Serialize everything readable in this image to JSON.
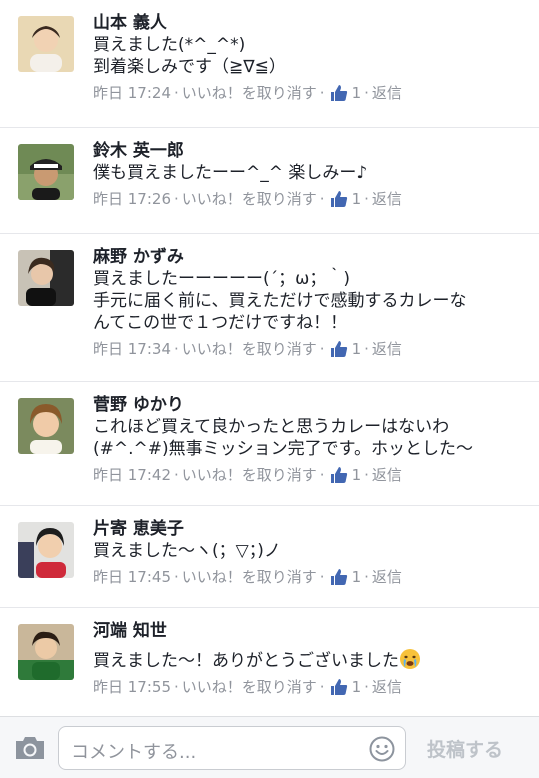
{
  "comments": [
    {
      "name": "山本 義人",
      "lines": [
        "買えました(*^_^*)",
        "到着楽しみです（≧∇≦）"
      ],
      "time": "昨日 17:24",
      "unlike": "いいね！を取り消す",
      "likes": "1",
      "reply": "返信"
    },
    {
      "name": "鈴木 英一郎",
      "lines": [
        "僕も買えましたーー^_^ 楽しみー♪"
      ],
      "time": "昨日 17:26",
      "unlike": "いいね！を取り消す",
      "likes": "1",
      "reply": "返信"
    },
    {
      "name": "麻野 かずみ",
      "lines": [
        "買えましたーーーーー(´；ω；｀)",
        "手元に届く前に、買えただけで感動するカレーな",
        "んてこの世で１つだけですね！！"
      ],
      "time": "昨日 17:34",
      "unlike": "いいね！を取り消す",
      "likes": "1",
      "reply": "返信"
    },
    {
      "name": "菅野 ゆかり",
      "lines": [
        "これほど買えて良かったと思うカレーはないわ",
        "(#^.^#)無事ミッション完了です。ホッとした〜"
      ],
      "time": "昨日 17:42",
      "unlike": "いいね！を取り消す",
      "likes": "1",
      "reply": "返信"
    },
    {
      "name": "片寄 恵美子",
      "lines": [
        "買えました〜ヽ(；▽；)ノ"
      ],
      "time": "昨日 17:45",
      "unlike": "いいね！を取り消す",
      "likes": "1",
      "reply": "返信"
    },
    {
      "name": "河端 知世",
      "lines": [
        "買えました〜！ありがとうございました"
      ],
      "time": "昨日 17:55",
      "unlike": "いいね！を取り消す",
      "likes": "1",
      "reply": "返信"
    }
  ],
  "composer": {
    "placeholder": "コメントする...",
    "post_label": "投稿する"
  },
  "icons": {
    "like": "thumbs-up-icon",
    "camera": "camera-icon",
    "smiley": "smiley-icon",
    "crying": "crying-face-emoji"
  },
  "colors": {
    "like_blue": "#4267b2",
    "meta_gray": "#90949c",
    "post_disabled": "#bec3c9"
  }
}
